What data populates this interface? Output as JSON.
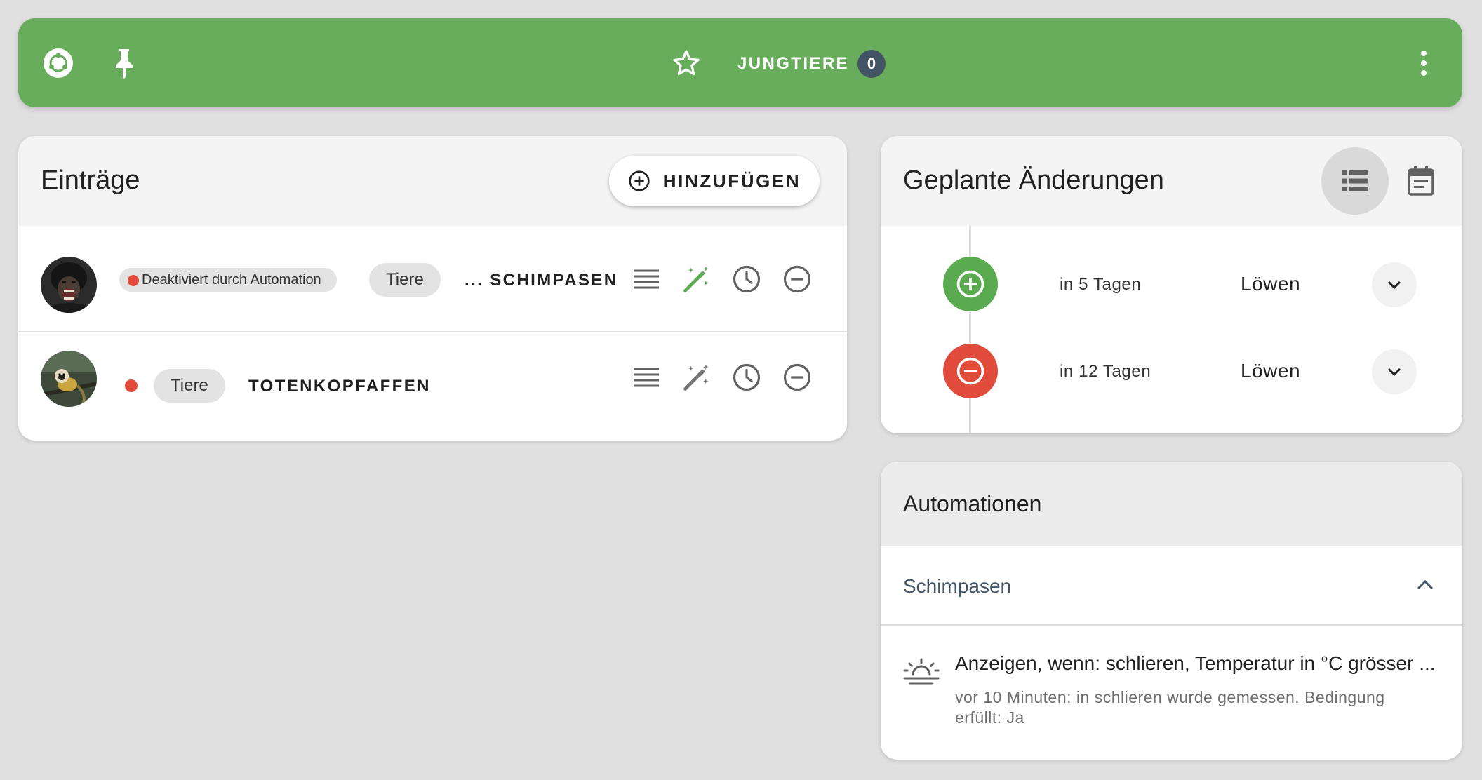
{
  "topbar": {
    "logo_icon": "home-assistant-logo-icon",
    "pin_icon": "pin-icon",
    "favorite_icon": "star-outline-icon",
    "tab_label": "JUNGTIERE",
    "tab_count": "0",
    "more_icon": "dots-vertical-icon",
    "color": "#68ad5c"
  },
  "entries": {
    "title": "Einträge",
    "add_label": "HINZUFÜGEN",
    "rows": [
      {
        "status": "Deaktiviert durch Automation",
        "tag": "Tiere",
        "name": "... SCHIMPASEN",
        "avatar": "chimpanzee-avatar",
        "wand_color": "#5aab4f"
      },
      {
        "status": "",
        "tag": "Tiere",
        "name": "TOTENKOPFAFFEN",
        "avatar": "squirrel-monkey-avatar",
        "wand_color": "#757575"
      }
    ]
  },
  "scheduled": {
    "title": "Geplante Änderungen",
    "items": [
      {
        "type": "add",
        "when": "in 5 Tagen",
        "what": "Löwen"
      },
      {
        "type": "remove",
        "when": "in 12 Tagen",
        "what": "Löwen"
      }
    ]
  },
  "automations": {
    "title": "Automationen",
    "group": "Schimpasen",
    "item": {
      "icon": "weather-sunset-icon",
      "title": "Anzeigen, wenn: schlieren, Temperatur in °C grösser ...",
      "subtitle": "vor 10 Minuten: in schlieren wurde gemessen. Bedingung erfüllt: Ja"
    }
  }
}
